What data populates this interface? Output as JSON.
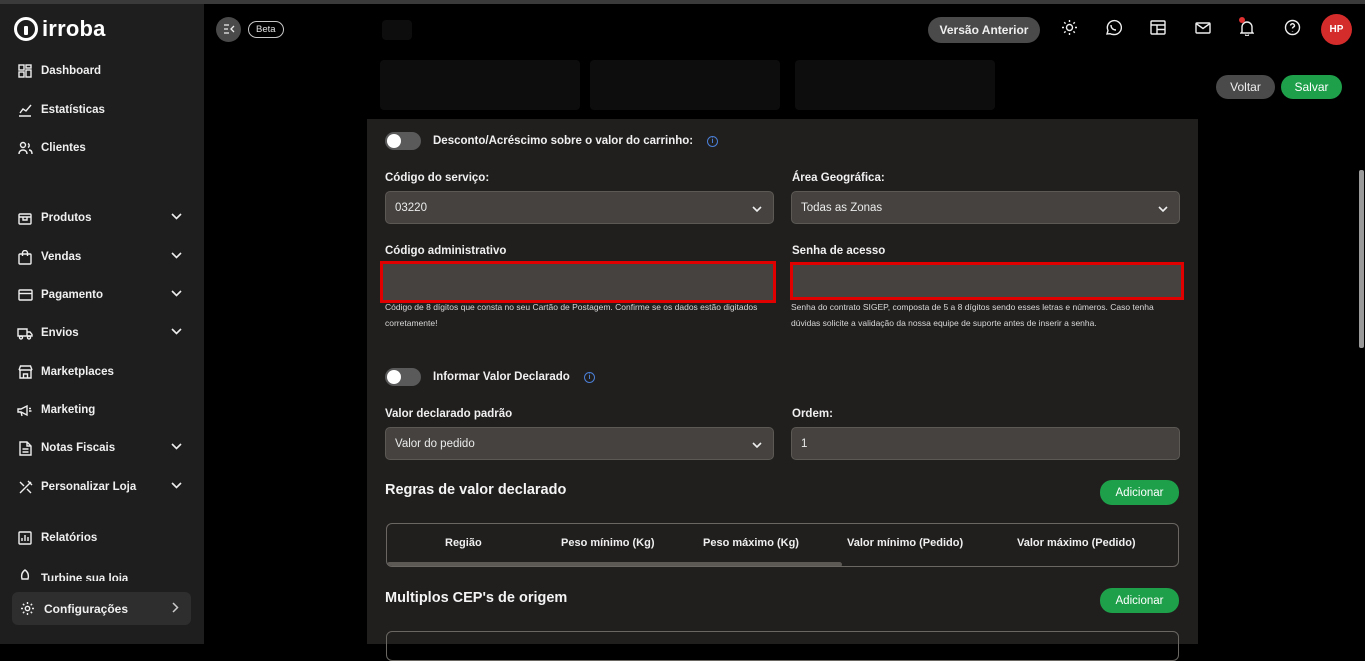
{
  "brand": {
    "name": "irroba"
  },
  "sidebar": {
    "items": [
      {
        "label": "Dashboard",
        "icon": "grid-icon"
      },
      {
        "label": "Estatísticas",
        "icon": "chart-icon"
      },
      {
        "label": "Clientes",
        "icon": "users-icon"
      },
      {
        "label": "Produtos",
        "icon": "box-icon"
      },
      {
        "label": "Vendas",
        "icon": "bag-icon"
      },
      {
        "label": "Pagamento",
        "icon": "card-icon"
      },
      {
        "label": "Envios",
        "icon": "truck-icon"
      },
      {
        "label": "Marketplaces",
        "icon": "store-icon"
      },
      {
        "label": "Marketing",
        "icon": "megaphone-icon"
      },
      {
        "label": "Notas Fiscais",
        "icon": "document-icon"
      },
      {
        "label": "Personalizar Loja",
        "icon": "tools-icon"
      },
      {
        "label": "Relatórios",
        "icon": "report-icon"
      },
      {
        "label": "Turbine sua loja",
        "icon": "rocket-icon"
      }
    ],
    "config_label": "Configurações"
  },
  "header": {
    "beta": "Beta",
    "previous_version": "Versão Anterior",
    "avatar_initials": "HP"
  },
  "actions": {
    "back": "Voltar",
    "save": "Salvar"
  },
  "form": {
    "discount_toggle_label": "Desconto/Acréscimo sobre o valor do carrinho:",
    "service_code_label": "Código do serviço:",
    "service_code_value": "03220",
    "area_label": "Área Geográfica:",
    "area_value": "Todas as Zonas",
    "admin_code_label": "Código administrativo",
    "admin_code_value": "",
    "admin_code_help": "Código de 8 dígitos que consta no seu Cartão de Postagem. Confirme se os dados estão digitados corretamente!",
    "password_label": "Senha de acesso",
    "password_value": "",
    "password_help": "Senha do contrato SIGEP, composta de 5 a 8 dígitos sendo esses letras e números. Caso tenha dúvidas solicite a validação da nossa equipe de suporte antes de inserir a senha.",
    "declared_toggle_label": "Informar Valor Declarado",
    "declared_default_label": "Valor declarado padrão",
    "declared_default_value": "Valor do pedido",
    "order_label": "Ordem:",
    "order_value": "1"
  },
  "rules": {
    "title": "Regras de valor declarado",
    "add": "Adicionar",
    "columns": [
      "Região",
      "Peso mínimo (Kg)",
      "Peso máximo (Kg)",
      "Valor mínimo (Pedido)",
      "Valor máximo (Pedido)"
    ]
  },
  "origins": {
    "title": "Multiplos CEP's de origem",
    "add": "Adicionar"
  },
  "colors": {
    "accent_green": "#1ea04a",
    "alert_red": "#e00000",
    "avatar_red": "#d42b2b",
    "info_blue": "#4a7fd6"
  }
}
